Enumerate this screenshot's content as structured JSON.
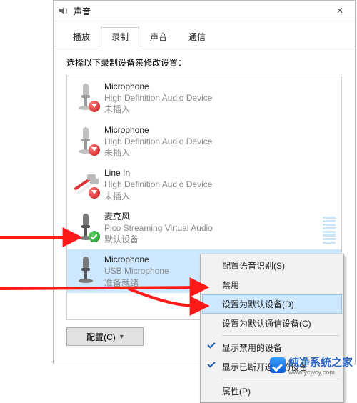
{
  "window": {
    "title": "声音",
    "close_glyph": "✕"
  },
  "tabs": [
    {
      "label": "播放"
    },
    {
      "label": "录制"
    },
    {
      "label": "声音"
    },
    {
      "label": "通信"
    }
  ],
  "active_tab_index": 1,
  "hint": "选择以下录制设备来修改设置：",
  "devices": [
    {
      "name": "Microphone",
      "sub": "High Definition Audio Device",
      "status": "未插入",
      "badge": "red",
      "icon": "mic",
      "selected": false
    },
    {
      "name": "Microphone",
      "sub": "High Definition Audio Device",
      "status": "未插入",
      "badge": "red",
      "icon": "mic",
      "selected": false
    },
    {
      "name": "Line In",
      "sub": "High Definition Audio Device",
      "status": "未插入",
      "badge": "red",
      "icon": "linein",
      "selected": false
    },
    {
      "name": "麦克风",
      "sub": "Pico Streaming Virtual Audio",
      "status": "默认设备",
      "badge": "green",
      "icon": "mic",
      "selected": false
    },
    {
      "name": "Microphone",
      "sub": "USB Microphone",
      "status": "准备就绪",
      "badge": "none",
      "icon": "mic",
      "selected": true
    }
  ],
  "buttons": {
    "configure": "配置(C)",
    "properties": "属性(P)"
  },
  "context_menu": {
    "items": [
      {
        "label": "配置语音识别(S)"
      },
      {
        "label": "禁用"
      },
      {
        "label": "设置为默认设备(D)",
        "highlighted": true
      },
      {
        "label": "设置为默认通信设备(C)"
      }
    ],
    "separator1": true,
    "checks": [
      {
        "label": "显示禁用的设备",
        "checked": true
      },
      {
        "label": "显示已断开连接的设备",
        "checked": true
      }
    ],
    "separator2": true,
    "last": {
      "label": "属性(P)"
    }
  },
  "watermark": {
    "text": "纯净系统之家",
    "url": "www.ycwcy.com"
  }
}
